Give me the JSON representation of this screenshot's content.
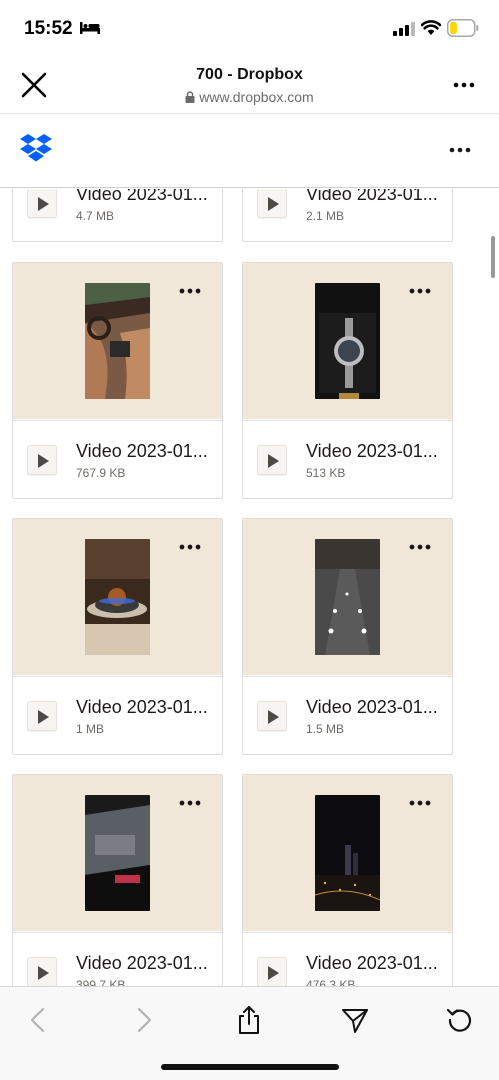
{
  "status_bar": {
    "time": "15:52",
    "icons": [
      "bed-icon",
      "cellular-signal-icon",
      "wifi-icon",
      "battery-icon"
    ],
    "battery_level": 0.3,
    "battery_color": "#ffd60a"
  },
  "browser": {
    "title": "700 - Dropbox",
    "url": "www.dropbox.com",
    "close_icon": "close-icon",
    "lock_icon": "lock-icon",
    "more_icon": "more-horizontal-icon"
  },
  "dropbox_bar": {
    "logo": "dropbox-logo",
    "logo_color": "#0061fe",
    "more_icon": "more-horizontal-icon"
  },
  "files": [
    {
      "name": "Video 2023-01...",
      "size": "4.7 MB",
      "thumbnail": "none"
    },
    {
      "name": "Video 2023-01...",
      "size": "2.1 MB",
      "thumbnail": "none"
    },
    {
      "name": "Video 2023-01...",
      "size": "767.9 KB",
      "thumbnail": "car-interior"
    },
    {
      "name": "Video 2023-01...",
      "size": "513 KB",
      "thumbnail": "watch-in-box"
    },
    {
      "name": "Video 2023-01...",
      "size": "1 MB",
      "thumbnail": "dessert-dish"
    },
    {
      "name": "Video 2023-01...",
      "size": "1.5 MB",
      "thumbnail": "marble-lobby"
    },
    {
      "name": "Video 2023-01...",
      "size": "399.7 KB",
      "thumbnail": "car-window-night"
    },
    {
      "name": "Video 2023-01...",
      "size": "476.3 KB",
      "thumbnail": "city-night"
    }
  ],
  "colors": {
    "thumb_background": "#f0e7d9",
    "accent": "#0061fe"
  },
  "toolbar": {
    "icons": [
      "back-arrow-icon",
      "forward-arrow-icon",
      "share-icon",
      "send-icon",
      "refresh-icon"
    ]
  }
}
